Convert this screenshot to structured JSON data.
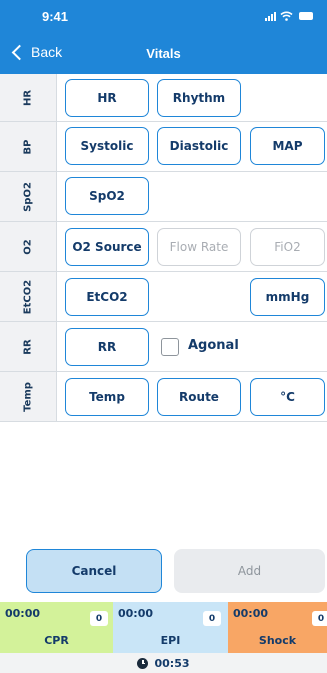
{
  "status_bar": {
    "time": "9:41"
  },
  "nav": {
    "back_label": "Back",
    "title": "Vitals"
  },
  "rows": {
    "hr": {
      "label": "HR",
      "buttons": [
        "HR",
        "Rhythm"
      ]
    },
    "bp": {
      "label": "BP",
      "buttons": [
        "Systolic",
        "Diastolic",
        "MAP"
      ]
    },
    "spo2": {
      "label": "SpO2",
      "buttons": [
        "SpO2"
      ]
    },
    "o2": {
      "label": "O2",
      "buttons": [
        "O2 Source",
        "Flow Rate",
        "FiO2"
      ]
    },
    "etco2": {
      "label": "EtCO2",
      "buttons": [
        "EtCO2",
        "mmHg"
      ]
    },
    "rr": {
      "label": "RR",
      "buttons": [
        "RR"
      ],
      "checkbox_label": "Agonal",
      "checkbox_checked": false
    },
    "temp": {
      "label": "Temp",
      "buttons": [
        "Temp",
        "Route",
        "°C"
      ]
    }
  },
  "actions": {
    "cancel_label": "Cancel",
    "add_label": "Add"
  },
  "timers": [
    {
      "time": "00:00",
      "count": "0",
      "label": "CPR",
      "color": "#d3f29a"
    },
    {
      "time": "00:00",
      "count": "0",
      "label": "EPI",
      "color": "#c9e5f7"
    },
    {
      "time": "00:00",
      "count": "0",
      "label": "Shock",
      "color": "#f8a665"
    }
  ],
  "total_timer": {
    "time": "00:53"
  },
  "colors": {
    "accent": "#1f86d8",
    "text": "#143b6a"
  }
}
